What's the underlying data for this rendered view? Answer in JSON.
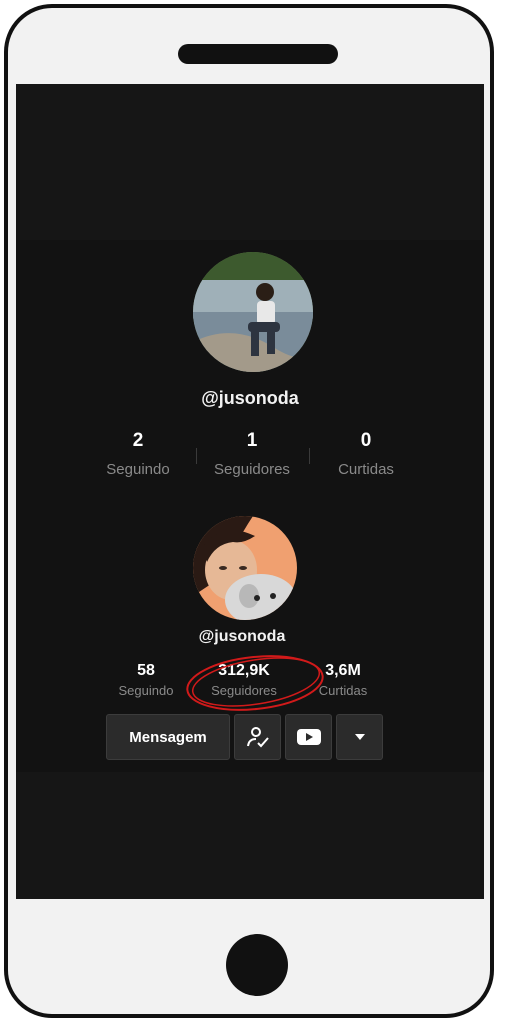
{
  "profile_top": {
    "handle": "@jusonoda",
    "stats": [
      {
        "value": "2",
        "label": "Seguindo"
      },
      {
        "value": "1",
        "label": "Seguidores"
      },
      {
        "value": "0",
        "label": "Curtidas"
      }
    ]
  },
  "profile_bottom": {
    "handle": "@jusonoda",
    "stats": [
      {
        "value": "58",
        "label": "Seguindo"
      },
      {
        "value": "312,9K",
        "label": "Seguidores"
      },
      {
        "value": "3,6M",
        "label": "Curtidas"
      }
    ],
    "buttons": {
      "message_label": "Mensagem",
      "following_icon": "user-check-icon",
      "youtube_icon": "youtube-icon",
      "more_icon": "caret-down-icon"
    }
  },
  "colors": {
    "screen_bg": "#161616",
    "panel_bg": "#121212",
    "annotation_red": "#d11a1a",
    "label_gray": "#8a8a8a"
  }
}
